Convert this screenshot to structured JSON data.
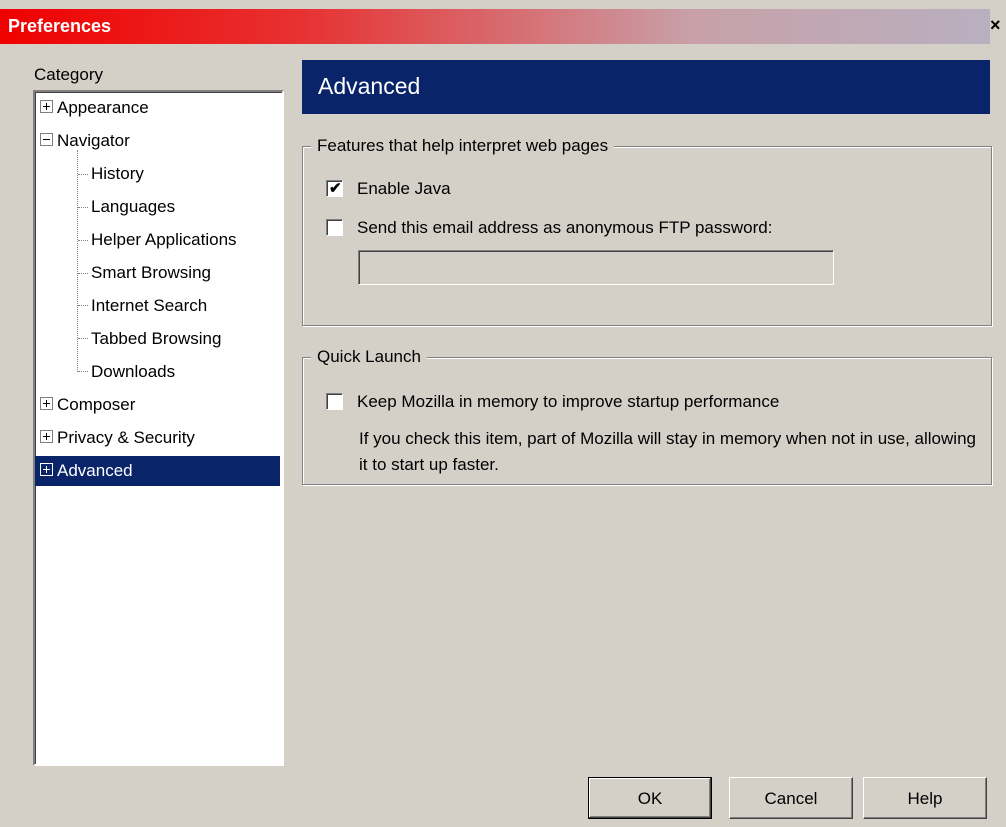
{
  "window": {
    "title": "Preferences",
    "close_glyph": "×"
  },
  "sidebar": {
    "category_label": "Category",
    "items": [
      {
        "label": "Appearance",
        "expander": "plus"
      },
      {
        "label": "Navigator",
        "expander": "minus"
      },
      {
        "label": "History"
      },
      {
        "label": "Languages"
      },
      {
        "label": "Helper Applications"
      },
      {
        "label": "Smart Browsing"
      },
      {
        "label": "Internet Search"
      },
      {
        "label": "Tabbed Browsing"
      },
      {
        "label": "Downloads"
      },
      {
        "label": "Composer",
        "expander": "plus"
      },
      {
        "label": "Privacy & Security",
        "expander": "plus"
      },
      {
        "label": "Advanced",
        "expander": "plus",
        "selected": true
      }
    ]
  },
  "panel": {
    "title": "Advanced",
    "features_group": {
      "legend": "Features that help interpret web pages",
      "enable_java": {
        "label": "Enable Java",
        "checked": true
      },
      "send_email": {
        "label": "Send this email address as anonymous FTP password:",
        "checked": false
      },
      "email_value": ""
    },
    "quick_launch_group": {
      "legend": "Quick Launch",
      "keep_mozilla": {
        "label": "Keep Mozilla in memory to improve startup performance",
        "checked": false
      },
      "description": "If you check this item, part of Mozilla will stay in memory when not in use, allowing it to start up faster."
    }
  },
  "buttons": {
    "ok": "OK",
    "cancel": "Cancel",
    "help": "Help"
  },
  "colors": {
    "selection": "#0a246a",
    "titlebar_start": "#f00000",
    "dialog_bg": "#d4d0c8"
  }
}
